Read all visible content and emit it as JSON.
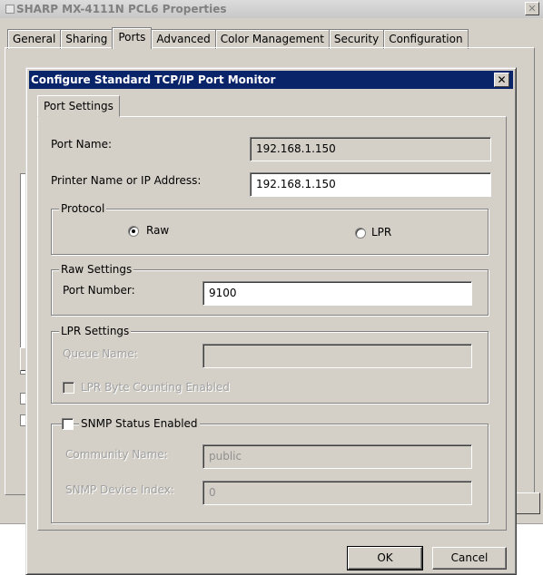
{
  "outer_window": {
    "title": "SHARP MX-4111N PCL6 Properties",
    "tabs": [
      "General",
      "Sharing",
      "Ports",
      "Advanced",
      "Color Management",
      "Security",
      "Configuration"
    ],
    "active_tab": "Ports"
  },
  "dialog": {
    "title": "Configure Standard TCP/IP Port Monitor",
    "tab": "Port Settings",
    "port_name_label": "Port Name:",
    "port_name_value": "192.168.1.150",
    "printer_name_label": "Printer Name or IP Address:",
    "printer_name_value": "192.168.1.150",
    "protocol": {
      "title": "Protocol",
      "raw_label": "Raw",
      "lpr_label": "LPR",
      "selected": "Raw"
    },
    "raw_settings": {
      "title": "Raw Settings",
      "port_number_label": "Port Number:",
      "port_number_value": "9100"
    },
    "lpr_settings": {
      "title": "LPR Settings",
      "queue_name_label": "Queue Name:",
      "queue_name_value": "",
      "byte_counting_label": "LPR Byte Counting Enabled"
    },
    "snmp": {
      "enabled_label": "SNMP Status Enabled",
      "community_label": "Community Name:",
      "community_value": "public",
      "device_index_label": "SNMP Device Index:",
      "device_index_value": "0"
    },
    "ok_label": "OK",
    "cancel_label": "Cancel"
  }
}
